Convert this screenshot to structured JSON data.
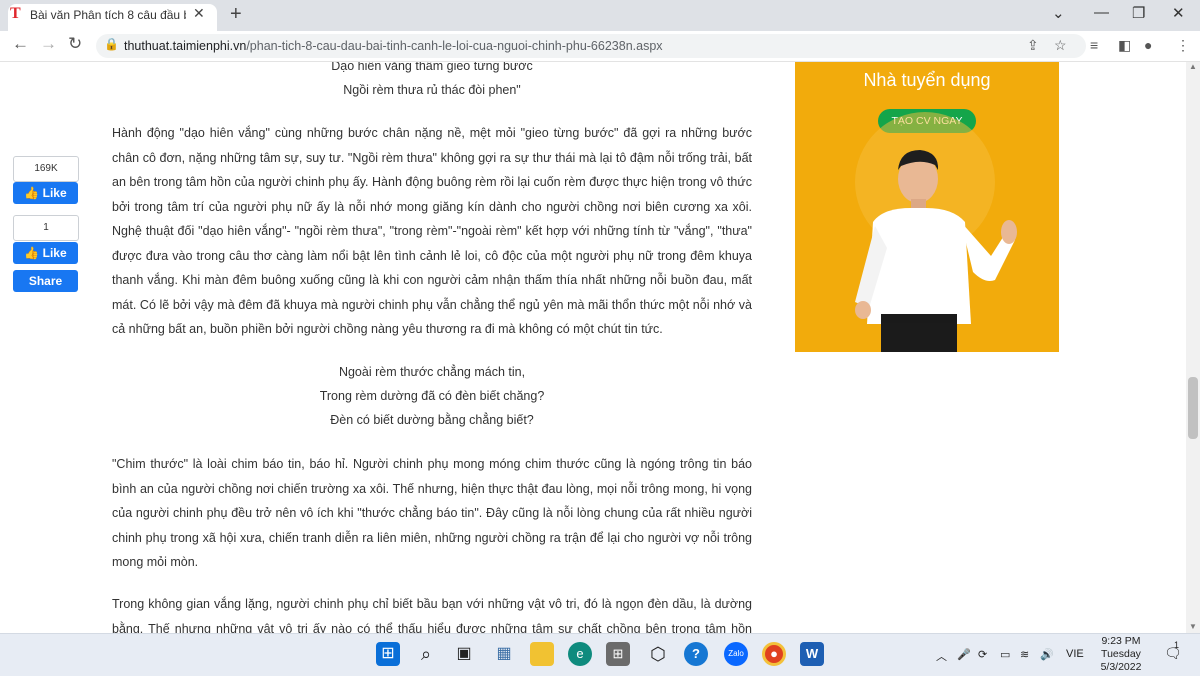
{
  "browser": {
    "tab_favicon": "T",
    "tab_title": "Bài văn Phân tích 8 câu đầu bài T",
    "url_domain": "thuthuat.taimienphi.vn",
    "url_path": "/phan-tich-8-cau-dau-bai-tinh-canh-le-loi-cua-nguoi-chinh-phu-66238n.aspx"
  },
  "article": {
    "poem1": [
      "Dạo hiên vắng thầm gieo từng bước",
      "Ngồi rèm thưa rủ thác đòi phen\""
    ],
    "para1": "Hành động \"dạo hiên vắng\" cùng những bước chân nặng nề, mệt mỏi \"gieo từng bước\" đã gợi ra những bước chân cô đơn, nặng những tâm sự, suy tư. \"Ngồi rèm thưa\" không gợi ra sự thư thái mà lại tô đậm nỗi trống trải, bất an bên trong tâm hồn của người chinh phụ ấy. Hành động buông rèm rồi lại cuốn rèm được thực hiện trong vô thức bởi trong tâm trí của người phụ nữ ấy là nỗi nhớ mong giăng kín dành cho người chồng nơi biên cương xa xôi. Nghệ thuật đối \"dạo hiên vắng\"- \"ngồi rèm thưa\", \"trong rèm\"-\"ngoài rèm\" kết hợp với những tính từ \"vắng\", \"thưa\" được đưa vào trong câu thơ càng làm nổi bật lên tình cảnh lẻ loi, cô độc của một người phụ nữ trong đêm khuya thanh vắng. Khi màn đêm buông xuống cũng là khi con người cảm nhận thấm thía nhất những nỗi buồn đau, mất mát. Có lẽ bởi vậy mà đêm đã khuya mà người chinh phụ vẫn chẳng thể ngủ yên mà mãi thổn thức một nỗi nhớ và cả những bất an, buồn phiền bởi người chồng nàng yêu thương ra đi mà không có một chút tin tức.",
    "poem2": [
      "Ngoài rèm thước chẳng mách tin,",
      "Trong rèm dường đã có đèn biết chăng?",
      "Đèn có biết dường bằng chẳng biết?"
    ],
    "para2": "\"Chim thước\" là loài chim báo tin, báo hỉ. Người chinh phụ mong móng chim thước cũng là ngóng trông tin báo bình an của người chồng nơi chiến trường xa xôi. Thế nhưng, hiện thực thật đau lòng, mọi nỗi trông mong, hi vọng của người chinh phụ đều trở nên vô ích khi \"thước chẳng báo tin\". Đây cũng là nỗi lòng chung của rất nhiều người chinh phụ trong xã hội xưa, chiến tranh diễn ra liên miên, những người chồng ra trận để lại cho người vợ nỗi trông mong mỏi mòn.",
    "para3": "Trong không gian vắng lặng, người chinh phụ chỉ biết bầu bạn với những vật vô tri, đó là ngọn đèn dầu, là dường bằng. Thế nhưng những vật vô tri ấy nào có thể thấu hiểu được những tâm sự chất chồng bên trong tâm hồn người"
  },
  "social": {
    "count1": "169K",
    "like1": "Like",
    "count2": "1",
    "like2": "Like",
    "share": "Share"
  },
  "ad": {
    "title": "Nhà tuyển dụng",
    "cta": "TẠO CV NGAY"
  },
  "taskbar": {
    "lang": "VIE",
    "time": "9:23 PM",
    "day": "Tuesday",
    "date": "5/3/2022",
    "notif_count": "1"
  },
  "colors": {
    "fb_blue": "#1877f2",
    "ad_orange": "#f2ab0c",
    "cta_green": "#14a54a",
    "favicon_red": "#e0262c"
  }
}
